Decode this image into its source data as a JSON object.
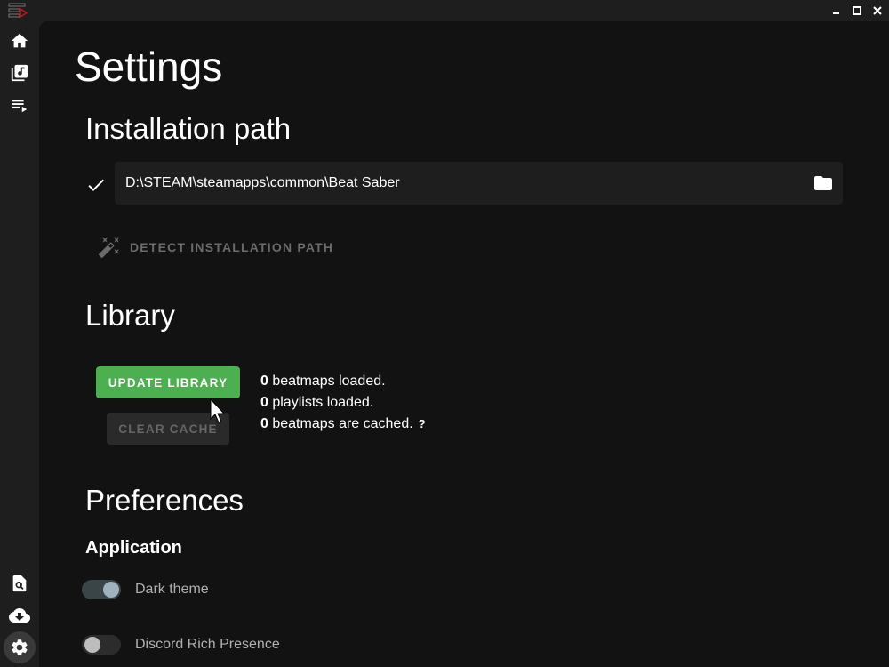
{
  "window": {
    "controls": {
      "minimize": "minimize-icon",
      "maximize": "maximize-icon",
      "close": "close-icon"
    }
  },
  "sidebar": {
    "top_items": [
      {
        "icon": "home-icon",
        "label": "Home"
      },
      {
        "icon": "music-library-icon",
        "label": "Library"
      },
      {
        "icon": "playlist-icon",
        "label": "Playlists"
      }
    ],
    "bottom_items": [
      {
        "icon": "search-file-icon",
        "label": "Search"
      },
      {
        "icon": "cloud-download-icon",
        "label": "Downloads"
      },
      {
        "icon": "gear-icon",
        "label": "Settings",
        "active": true
      }
    ]
  },
  "page": {
    "title": "Settings"
  },
  "installation": {
    "heading": "Installation path",
    "path_value": "D:\\STEAM\\steamapps\\common\\Beat Saber",
    "valid": true,
    "detect_label": "DETECT INSTALLATION PATH"
  },
  "library": {
    "heading": "Library",
    "update_label": "UPDATE LIBRARY",
    "clear_label": "CLEAR CACHE",
    "stats": [
      {
        "count": "0",
        "text": " beatmaps loaded."
      },
      {
        "count": "0",
        "text": " playlists loaded."
      },
      {
        "count": "0",
        "text": " beatmaps are cached.",
        "help": "?"
      }
    ]
  },
  "preferences": {
    "heading": "Preferences",
    "application_heading": "Application",
    "toggles": [
      {
        "label": "Dark theme",
        "on": true
      },
      {
        "label": "Discord Rich Presence",
        "on": false
      }
    ]
  },
  "colors": {
    "accent_green": "#4caf50",
    "logo_red": "#c0161b",
    "background": "#121212",
    "chrome": "#1e1e1e"
  }
}
